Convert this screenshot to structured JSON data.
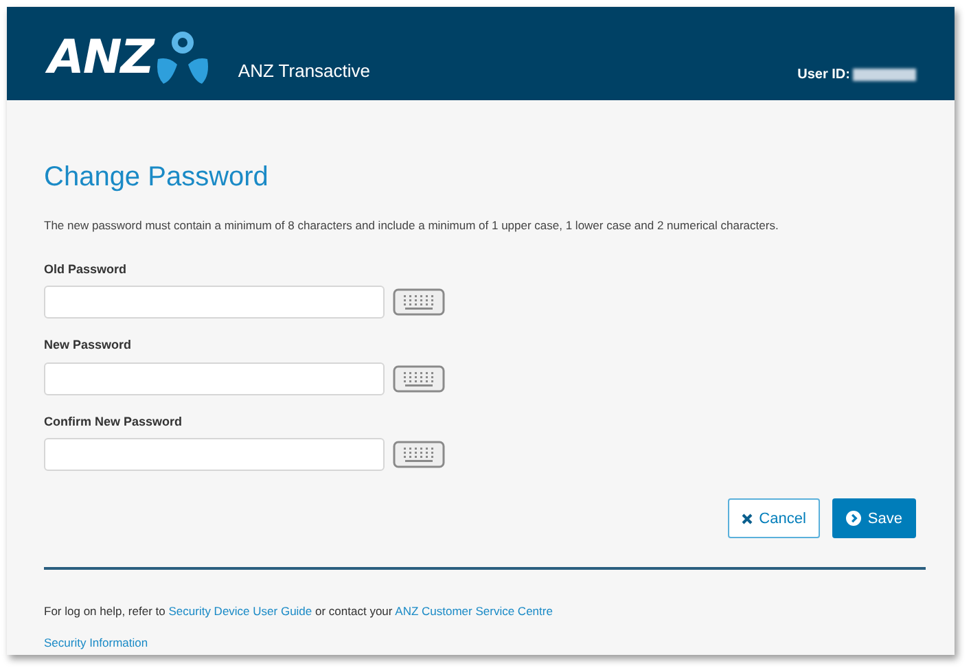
{
  "header": {
    "logo": "ANZ",
    "app_name": "ANZ Transactive",
    "user_label": "User ID:"
  },
  "page": {
    "title": "Change Password",
    "description": "The new password must contain a minimum of 8 characters and include a minimum of 1 upper case, 1 lower case and 2 numerical characters."
  },
  "fields": [
    {
      "label": "Old Password"
    },
    {
      "label": "New Password"
    },
    {
      "label": "Confirm New Password"
    }
  ],
  "buttons": [
    {
      "kind": "secondary",
      "label": "Cancel"
    },
    {
      "kind": "primary",
      "label": "Save"
    }
  ],
  "footer": {
    "help": [
      {
        "kind": "text",
        "text": "For log on help, refer to"
      },
      {
        "kind": "link",
        "text": "Security Device User Guide"
      },
      {
        "kind": "text",
        "text": "or contact your"
      },
      {
        "kind": "link",
        "text": "ANZ Customer Service Centre"
      }
    ],
    "links": [
      "Security Information"
    ]
  }
}
